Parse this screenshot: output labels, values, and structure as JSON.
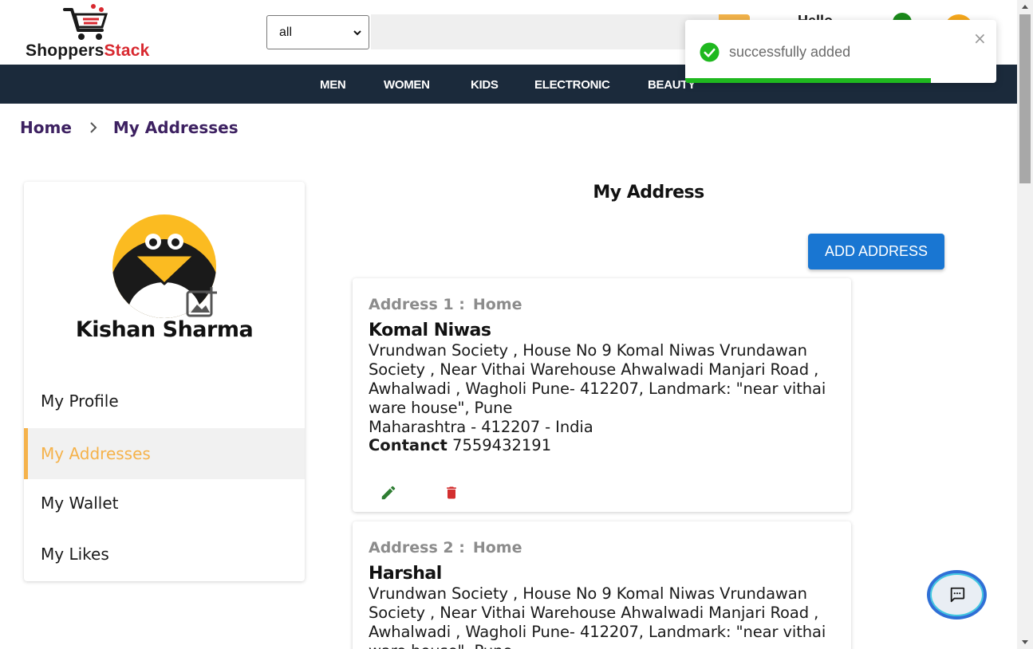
{
  "brand": {
    "part1": "Shoppers",
    "part2": "Stack"
  },
  "search": {
    "category_value": "all",
    "placeholder": ""
  },
  "header": {
    "greeting": "Hello"
  },
  "nav": {
    "items": [
      "MEN",
      "WOMEN",
      "KIDS",
      "ELECTRONIC",
      "BEAUTY"
    ]
  },
  "toast": {
    "message": "successfully added",
    "close": "×",
    "progress": 0.79
  },
  "breadcrumb": {
    "home": "Home",
    "current": "My Addresses"
  },
  "profile": {
    "name": "Kishan Sharma",
    "menu": [
      "My Profile",
      "My Addresses",
      "My Wallet",
      "My Likes"
    ],
    "active_index": 1
  },
  "main": {
    "title": "My Address",
    "add_button": "ADD ADDRESS",
    "addresses": [
      {
        "label": "Address 1 :",
        "type": "Home",
        "name": "Komal Niwas",
        "address": "Vrundwan Society , House No 9 Komal Niwas Vrundawan Society , Near Vithai Warehouse Ahwalwadi Manjari Road , Awhalwadi , Wagholi Pune- 412207, Landmark: \"near vithai ware house\", Pune",
        "state_line": "Maharashtra - 412207 - India",
        "contact_label": "Contanct",
        "contact": "7559432191"
      },
      {
        "label": "Address 2 :",
        "type": "Home",
        "name": "Harshal",
        "address": "Vrundwan Society , House No 9 Komal Niwas Vrundawan Society , Near Vithai Warehouse Ahwalwadi Manjari Road , Awhalwadi , Wagholi Pune- 412207, Landmark: \"near vithai ware house\", Pune"
      }
    ]
  },
  "colors": {
    "nav_bg": "#1b2a3b",
    "accent": "#f5b24a",
    "primary_button": "#1976d2",
    "success": "#1fb81f",
    "brand_red": "#d8282f"
  },
  "icons": [
    "cart-logo-icon",
    "chevron-down-icon",
    "search-icon",
    "check-circle-icon",
    "close-icon",
    "chevron-right-icon",
    "penguin-avatar-icon",
    "add-photo-icon",
    "edit-icon",
    "delete-icon",
    "chat-icon"
  ]
}
